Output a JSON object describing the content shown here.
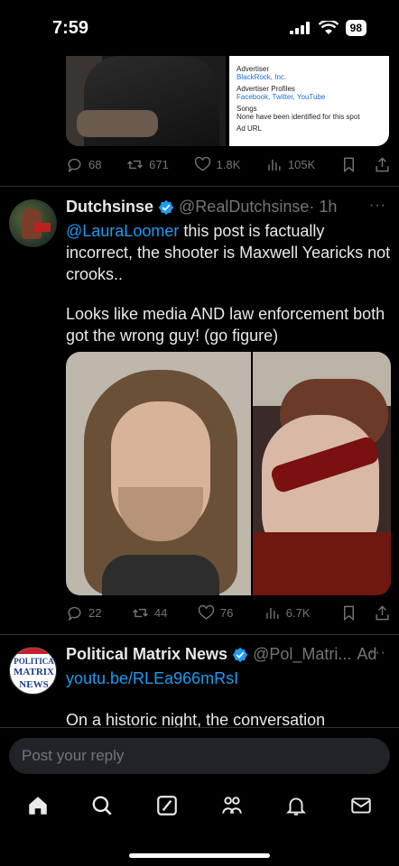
{
  "status_bar": {
    "time": "7:59",
    "battery": "98"
  },
  "tweet1": {
    "card": {
      "advertiser_label": "Advertiser",
      "advertiser_value": "BlackRock, Inc.",
      "profiles_label": "Advertiser Profiles",
      "profiles_value": "Facebook, Twitter, YouTube",
      "songs_label": "Songs",
      "songs_value": "None have been identified for this spot",
      "cut_label": "Ad URL"
    },
    "actions": {
      "replies": "68",
      "reposts": "671",
      "likes": "1.8K",
      "views": "105K"
    }
  },
  "tweet2": {
    "name": "Dutchsinse",
    "handle": "@RealDutchsinse",
    "time": "· 1h",
    "more": "···",
    "mention": "@LauraLoomer",
    "text1": " this post is factually incorrect, the shooter is Maxwell Yearicks not crooks..",
    "text2": "Looks like media AND law enforcement both got the wrong guy! (go figure)",
    "actions": {
      "replies": "22",
      "reposts": "44",
      "likes": "76",
      "views": "6.7K"
    }
  },
  "tweet3": {
    "name": "Political Matrix News",
    "handle": "@Pol_Matri...",
    "ad": "Ad",
    "more": "···",
    "link": "youtu.be/RLEa966mRsI",
    "text": "On a historic night, the conversation",
    "avatar_text": {
      "line1": "POLITICA",
      "line2": "MATRIX",
      "line3": "NEWS"
    }
  },
  "reply": {
    "placeholder": "Post your reply"
  },
  "nav": [
    "home-icon",
    "search-icon",
    "grok-icon",
    "communities-icon",
    "notifications-icon",
    "messages-icon"
  ],
  "colors": {
    "accent": "#1d9bf0",
    "muted": "#71767b",
    "text": "#e7e9ea",
    "background": "#000000"
  }
}
